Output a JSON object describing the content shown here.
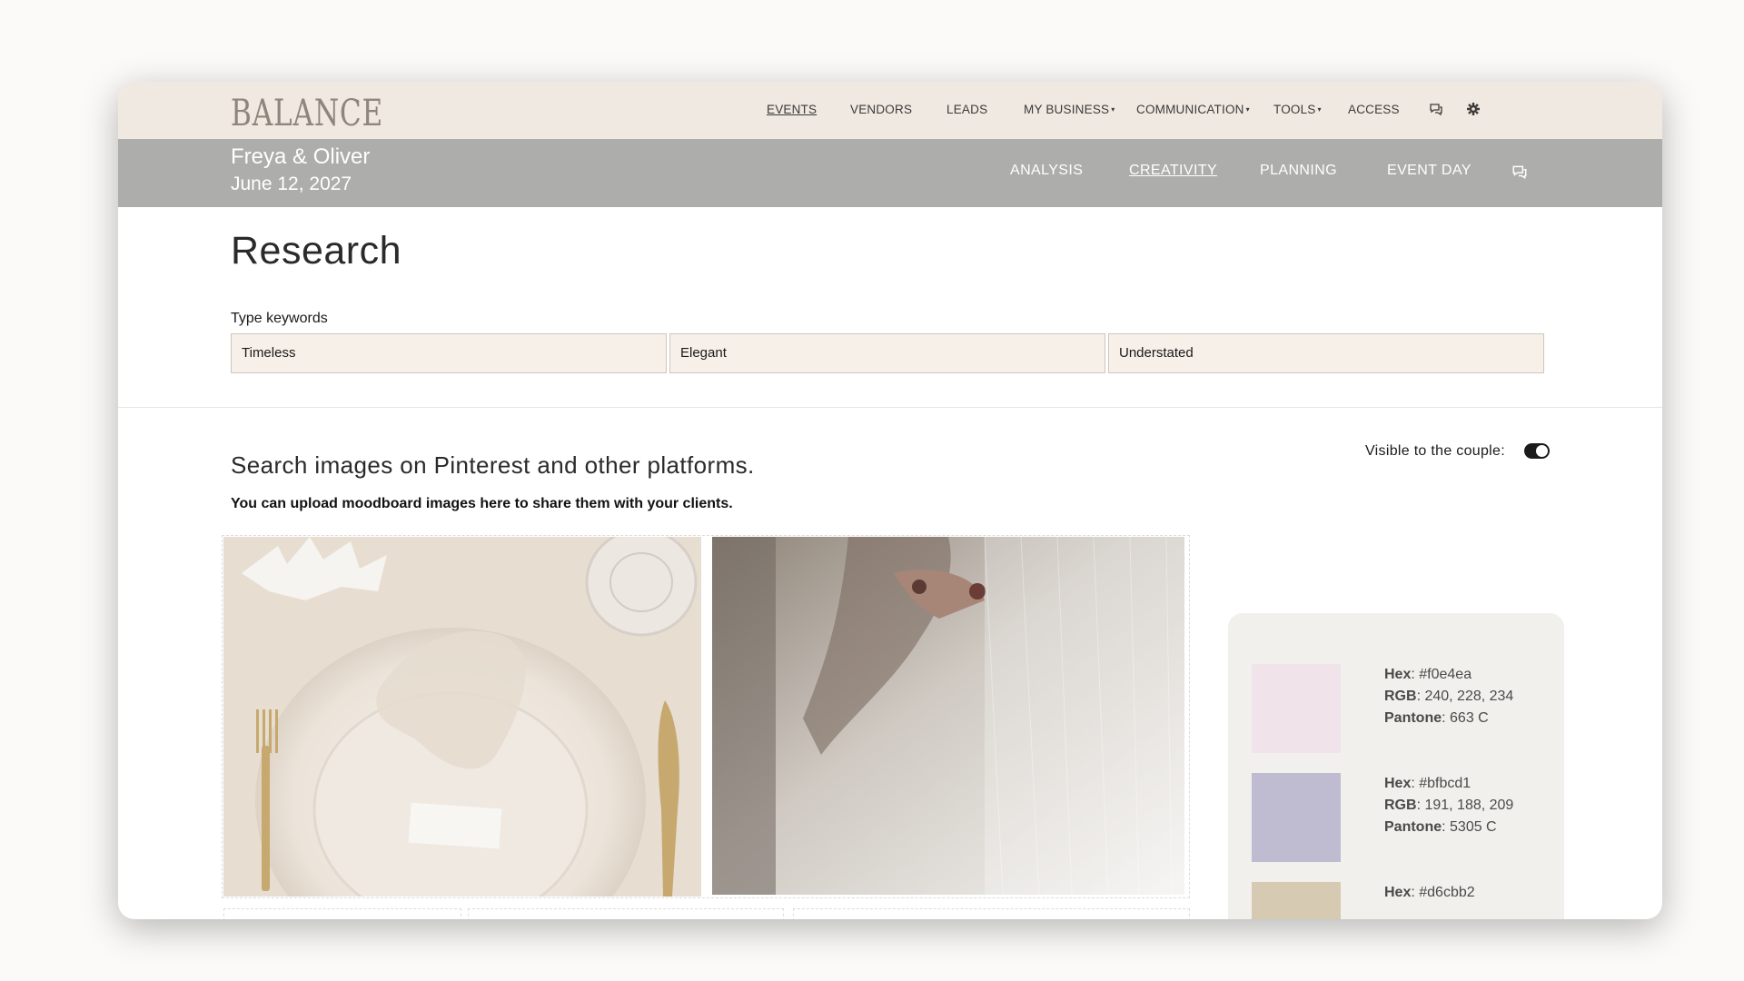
{
  "app": {
    "logo": "BALANCE"
  },
  "topnav": {
    "items": [
      {
        "label": "EVENTS",
        "active": true
      },
      {
        "label": "VENDORS"
      },
      {
        "label": "LEADS"
      },
      {
        "label": "MY BUSINESS",
        "dropdown": true
      },
      {
        "label": "COMMUNICATION",
        "dropdown": true
      },
      {
        "label": "TOOLS",
        "dropdown": true
      },
      {
        "label": "ACCESS"
      }
    ],
    "icons": [
      "chat-icon",
      "gear-icon"
    ]
  },
  "event": {
    "couple": "Freya & Oliver",
    "date": "June 12, 2027"
  },
  "subnav": {
    "items": [
      {
        "label": "ANALYSIS"
      },
      {
        "label": "CREATIVITY",
        "active": true
      },
      {
        "label": "PLANNING"
      },
      {
        "label": "EVENT DAY"
      }
    ],
    "icon": "chat-icon"
  },
  "research": {
    "title": "Research",
    "keywords_label": "Type keywords",
    "keywords": [
      "Timeless",
      "Elegant",
      "Understated"
    ]
  },
  "moodboard": {
    "heading": "Search images on Pinterest and other platforms.",
    "note": "You can upload moodboard images here to share them with your clients.",
    "visible_label": "Visible to the couple:",
    "visible": true,
    "images": [
      "table-setting-image",
      "bride-veil-image"
    ]
  },
  "palette": {
    "labels": {
      "hex": "Hex",
      "rgb": "RGB",
      "pantone": "Pantone"
    },
    "colors": [
      {
        "hex": "#f0e4ea",
        "rgb": "240, 228, 234",
        "pantone": "663 C"
      },
      {
        "hex": "#bfbcd1",
        "rgb": "191, 188, 209",
        "pantone": "5305 C"
      },
      {
        "hex": "#d6cbb2",
        "rgb": "",
        "pantone": ""
      }
    ]
  }
}
